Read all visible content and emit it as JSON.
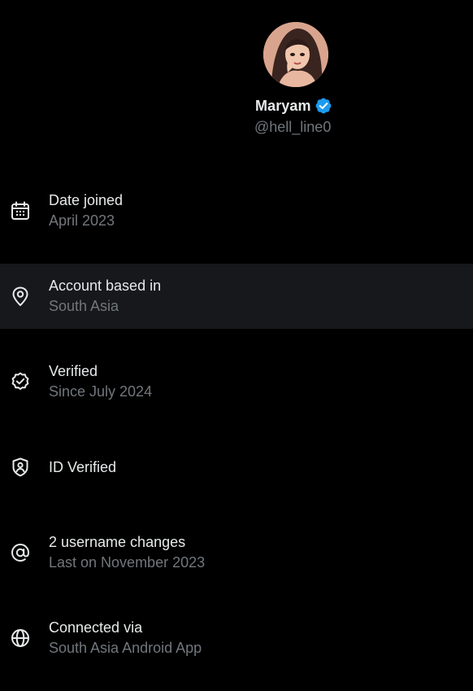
{
  "profile": {
    "display_name": "Maryam",
    "handle": "@hell_line0",
    "verified_color": "#1d9bf0"
  },
  "colors": {
    "background": "#000000",
    "primary_text": "#e7e9ea",
    "secondary_text": "#71767b",
    "hover_row": "#16181c"
  },
  "rows": [
    {
      "icon": "calendar-icon",
      "title": "Date joined",
      "subtitle": "April 2023"
    },
    {
      "icon": "location-pin-icon",
      "title": "Account based in",
      "subtitle": "South Asia"
    },
    {
      "icon": "verified-check-icon",
      "title": "Verified",
      "subtitle": "Since July 2024"
    },
    {
      "icon": "id-shield-icon",
      "title": "ID Verified",
      "subtitle": ""
    },
    {
      "icon": "at-sign-icon",
      "title": "2 username changes",
      "subtitle": "Last on November 2023"
    },
    {
      "icon": "globe-icon",
      "title": "Connected via",
      "subtitle": "South Asia Android App"
    }
  ]
}
